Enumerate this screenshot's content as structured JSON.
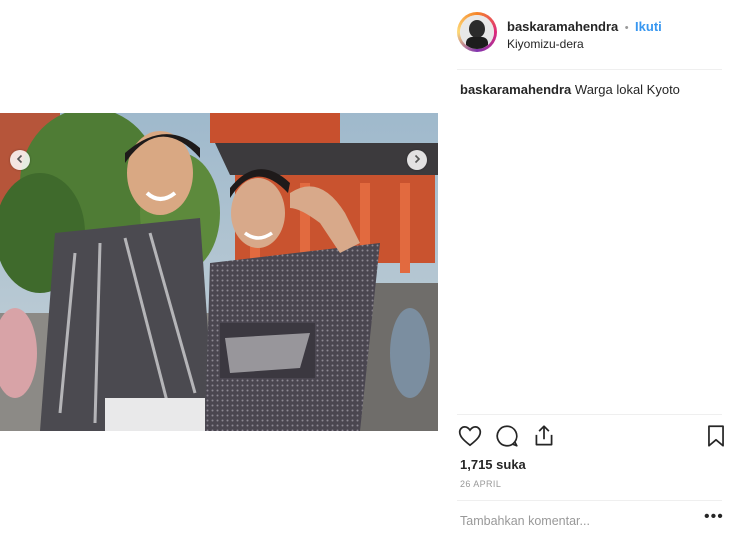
{
  "post": {
    "username": "baskaramahendra",
    "separator": "•",
    "follow_label": "Ikuti",
    "location": "Kiyomizu-dera",
    "caption_username": "baskaramahendra",
    "caption_text": "Warga lokal Kyoto",
    "likes": "1,715 suka",
    "date": "26 APRIL",
    "comment_placeholder": "Tambahkan komentar...",
    "more_label": "•••"
  },
  "icons": {
    "like": "heart-icon",
    "comment": "comment-icon",
    "share": "share-icon",
    "save": "bookmark-icon",
    "prev": "chevron-left-icon",
    "next": "chevron-right-icon"
  },
  "colors": {
    "accent": "#3897f0",
    "text": "#262626",
    "muted": "#999999",
    "divider": "#efefef"
  }
}
